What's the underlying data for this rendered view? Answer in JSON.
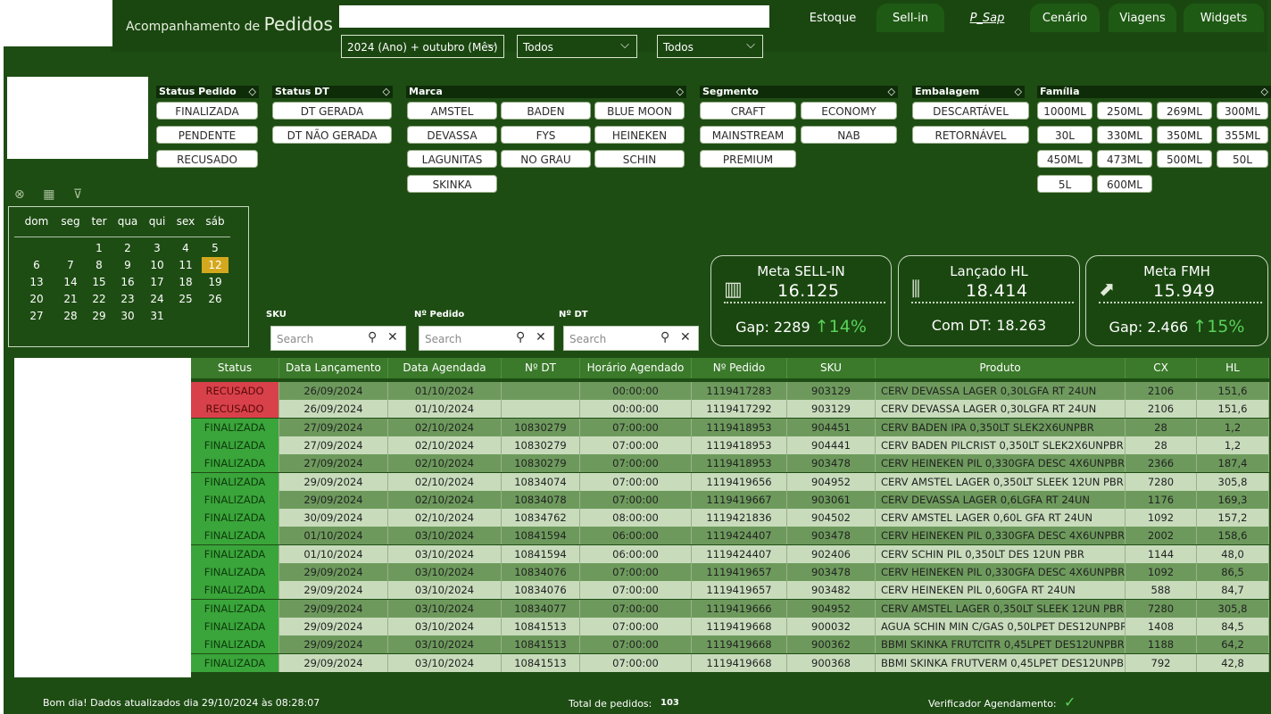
{
  "header": {
    "title_prefix": "Acompanhamento de ",
    "title_main": "Pedidos",
    "dropdowns": [
      {
        "value": "2024 (Ano) + outubro (Mês)"
      },
      {
        "value": "Todos"
      },
      {
        "value": "Todos"
      }
    ],
    "tabs": [
      "Estoque",
      "Sell-in",
      "P_Sap",
      "Cenário",
      "Viagens",
      "Widgets"
    ],
    "active_tab": "P_Sap"
  },
  "filters": {
    "status_pedido": {
      "title": "Status Pedido",
      "items": [
        "FINALIZADA",
        "PENDENTE",
        "RECUSADO"
      ]
    },
    "status_dt": {
      "title": "Status DT",
      "items": [
        "DT GERADA",
        "DT NÃO GERADA"
      ]
    },
    "marca": {
      "title": "Marca",
      "items": [
        "AMSTEL",
        "BADEN",
        "BLUE MOON",
        "DEVASSA",
        "FYS",
        "HEINEKEN",
        "LAGUNITAS",
        "NO GRAU",
        "SCHIN",
        "SKINKA"
      ]
    },
    "segmento": {
      "title": "Segmento",
      "items": [
        "CRAFT",
        "ECONOMY",
        "MAINSTREAM",
        "NAB",
        "PREMIUM"
      ]
    },
    "embalagem": {
      "title": "Embalagem",
      "items": [
        "DESCARTÁVEL",
        "RETORNÁVEL"
      ]
    },
    "familia": {
      "title": "Família",
      "items": [
        "1000ML",
        "250ML",
        "269ML",
        "300ML",
        "30L",
        "330ML",
        "350ML",
        "355ML",
        "450ML",
        "473ML",
        "500ML",
        "50L",
        "5L",
        "600ML"
      ]
    }
  },
  "calendar": {
    "weekdays": [
      "dom",
      "seg",
      "ter",
      "qua",
      "qui",
      "sex",
      "sáb"
    ],
    "weeks": [
      [
        "",
        "",
        "1",
        "2",
        "3",
        "4",
        "5"
      ],
      [
        "6",
        "7",
        "8",
        "9",
        "10",
        "11",
        "12"
      ],
      [
        "13",
        "14",
        "15",
        "16",
        "17",
        "18",
        "19"
      ],
      [
        "20",
        "21",
        "22",
        "23",
        "24",
        "25",
        "26"
      ],
      [
        "27",
        "28",
        "29",
        "30",
        "31",
        "",
        ""
      ]
    ],
    "selected_day": "12"
  },
  "searches": {
    "sku": {
      "label": "SKU",
      "placeholder": "Search"
    },
    "pedido": {
      "label": "Nº Pedido",
      "placeholder": "Search"
    },
    "dt": {
      "label": "Nº DT",
      "placeholder": "Search"
    }
  },
  "kpis": {
    "meta_sellin": {
      "title": "Meta SELL-IN",
      "value": "16.125",
      "gap_label": "Gap: 2289 ",
      "gap_pct": "↑14%"
    },
    "lancado_hl": {
      "title": "Lançado HL",
      "value": "18.414",
      "sub_label": "Com DT: 18.263"
    },
    "meta_fmh": {
      "title": "Meta FMH",
      "value": "15.949",
      "gap_label": "Gap: 2.466 ",
      "gap_pct": "↑15%"
    }
  },
  "table": {
    "columns": [
      "Status",
      "Data Lançamento",
      "Data Agendada",
      "Nº DT",
      "Horário Agendado",
      "Nº Pedido",
      "SKU",
      "Produto",
      "CX",
      "HL"
    ],
    "rows": [
      [
        "RECUSADO",
        "26/09/2024",
        "01/10/2024",
        "",
        "00:00:00",
        "1119417283",
        "903129",
        "CERV DEVASSA LAGER 0,30LGFA RT 24UN",
        "2106",
        "151,6"
      ],
      [
        "RECUSADO",
        "26/09/2024",
        "01/10/2024",
        "",
        "00:00:00",
        "1119417292",
        "903129",
        "CERV DEVASSA LAGER 0,30LGFA RT 24UN",
        "2106",
        "151,6"
      ],
      [
        "FINALIZADA",
        "27/09/2024",
        "02/10/2024",
        "10830279",
        "07:00:00",
        "1119418953",
        "904451",
        "CERV BADEN IPA 0,350LT SLEK2X6UNPBR",
        "28",
        "1,2"
      ],
      [
        "FINALIZADA",
        "27/09/2024",
        "02/10/2024",
        "10830279",
        "07:00:00",
        "1119418953",
        "904441",
        "CERV BADEN PILCRIST 0,350LT SLEK2X6UNPBR",
        "28",
        "1,2"
      ],
      [
        "FINALIZADA",
        "27/09/2024",
        "02/10/2024",
        "10830279",
        "07:00:00",
        "1119418953",
        "903478",
        "CERV HEINEKEN PIL 0,330GFA DESC 4X6UNPBR",
        "2366",
        "187,4"
      ],
      [
        "FINALIZADA",
        "29/09/2024",
        "02/10/2024",
        "10834074",
        "07:00:00",
        "1119419656",
        "904952",
        "CERV AMSTEL LAGER 0,350LT SLEEK 12UN PBR",
        "7280",
        "305,8"
      ],
      [
        "FINALIZADA",
        "29/09/2024",
        "02/10/2024",
        "10834078",
        "07:00:00",
        "1119419667",
        "903061",
        "CERV DEVASSA LAGER 0,6LGFA RT 24UN",
        "1176",
        "169,3"
      ],
      [
        "FINALIZADA",
        "30/09/2024",
        "02/10/2024",
        "10834762",
        "08:00:00",
        "1119421836",
        "904502",
        "CERV AMSTEL LAGER 0,60L GFA RT 24UN",
        "1092",
        "157,2"
      ],
      [
        "FINALIZADA",
        "01/10/2024",
        "03/10/2024",
        "10841594",
        "06:00:00",
        "1119424407",
        "903478",
        "CERV HEINEKEN PIL 0,330GFA DESC 4X6UNPBR",
        "2002",
        "158,6"
      ],
      [
        "FINALIZADA",
        "01/10/2024",
        "03/10/2024",
        "10841594",
        "06:00:00",
        "1119424407",
        "902406",
        "CERV SCHIN PIL 0,350LT DES 12UN PBR",
        "1144",
        "48,0"
      ],
      [
        "FINALIZADA",
        "29/09/2024",
        "03/10/2024",
        "10834076",
        "07:00:00",
        "1119419657",
        "903478",
        "CERV HEINEKEN PIL 0,330GFA DESC 4X6UNPBR",
        "1092",
        "86,5"
      ],
      [
        "FINALIZADA",
        "29/09/2024",
        "03/10/2024",
        "10834076",
        "07:00:00",
        "1119419657",
        "903482",
        "CERV HEINEKEN PIL 0,60GFA RT 24UN",
        "588",
        "84,7"
      ],
      [
        "FINALIZADA",
        "29/09/2024",
        "03/10/2024",
        "10834077",
        "07:00:00",
        "1119419666",
        "904952",
        "CERV AMSTEL LAGER 0,350LT SLEEK 12UN PBR",
        "7280",
        "305,8"
      ],
      [
        "FINALIZADA",
        "29/09/2024",
        "03/10/2024",
        "10841513",
        "07:00:00",
        "1119419668",
        "900032",
        "AGUA SCHIN MIN C/GAS 0,50LPET DES12UNPBR",
        "1408",
        "84,5"
      ],
      [
        "FINALIZADA",
        "29/09/2024",
        "03/10/2024",
        "10841513",
        "07:00:00",
        "1119419668",
        "900362",
        "BBMI SKINKA FRUTCITR 0,45LPET DES12UNPBR",
        "1188",
        "64,2"
      ],
      [
        "FINALIZADA",
        "29/09/2024",
        "03/10/2024",
        "10841513",
        "07:00:00",
        "1119419668",
        "900368",
        "BBMI SKINKA FRUTVERM 0,45LPET DES12UNPBR",
        "792",
        "42,8"
      ]
    ]
  },
  "footer": {
    "greeting": "Bom dia! Dados atualizados dia 29/10/2024 às 08:28:07",
    "total_label": "Total de pedidos:",
    "total_value": "103",
    "verificador_label": "Verificador Agendamento:",
    "verificador_icon": "✓"
  },
  "colors": {
    "background": "#1e4d14",
    "recusado": "#d9414a",
    "finalizada": "#3aa53a",
    "row_dark": "#6d9a5c",
    "row_light": "#c8dcbc",
    "check": "#5ad25a"
  }
}
